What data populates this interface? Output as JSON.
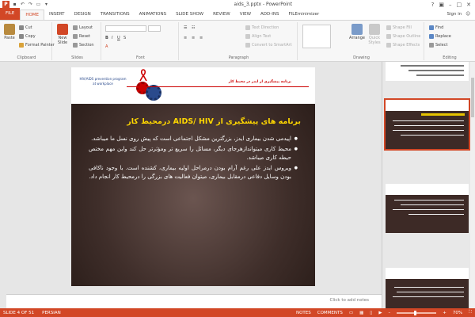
{
  "window": {
    "title": "aids_3.pptx - PowerPoint",
    "sign_in": "Sign in",
    "help": "?"
  },
  "tabs": [
    "FILE",
    "HOME",
    "INSERT",
    "DESIGN",
    "TRANSITIONS",
    "ANIMATIONS",
    "SLIDE SHOW",
    "REVIEW",
    "VIEW",
    "ADD-INS",
    "FILEminimizer"
  ],
  "ribbon": {
    "clipboard": {
      "label": "Clipboard",
      "paste": "Paste",
      "cut": "Cut",
      "copy": "Copy",
      "format_painter": "Format Painter"
    },
    "slides": {
      "label": "Slides",
      "new_slide": "New Slide",
      "layout": "Layout",
      "reset": "Reset",
      "section": "Section"
    },
    "font": {
      "label": "Font"
    },
    "paragraph": {
      "label": "Paragraph",
      "text_direction": "Text Direction",
      "align_text": "Align Text",
      "convert": "Convert to SmartArt"
    },
    "drawing": {
      "label": "Drawing",
      "arrange": "Arrange",
      "quick_styles": "Quick Styles",
      "shape_fill": "Shape Fill",
      "shape_outline": "Shape Outline",
      "shape_effects": "Shape Effects"
    },
    "editing": {
      "label": "Editing",
      "find": "Find",
      "replace": "Replace",
      "select": "Select"
    }
  },
  "slide": {
    "header_left": "HIV/AIDS prevention program at workplace",
    "header_right": "برنامه پیشگیری از ایدز در محیط کار",
    "title": "برنامه های پیشگیری از  AIDS/ HIV درمحیط کار",
    "bullets": [
      "اپیدمی شدن بیماری ایدز، بزرگترین مشکل اجتماعی است که پیش روی نسل ما میباشد.",
      "محیط کاری میتواندازهرجای دیگر، مسائل را سریع تر ومؤثرتر حل کند واین مهم مختص حیطه کاری میباشد.",
      "ویروس ایدز علی رغم آرام بودن درمراحل اولیه بیماری، کشنده است. با وجود ناکافی بودن وسایل دفاعی درمقابل بیماری، میتوان فعالیت های بزرگی را درمحیط کار انجام داد."
    ]
  },
  "notes_placeholder": "Click to add notes",
  "thumbnails": {
    "top_text": "بیان کنید که در انجام این وظیفه...",
    "numbers": [
      "4",
      "5",
      "6"
    ]
  },
  "status": {
    "slide": "SLIDE 4 OF 51",
    "language": "PERSIAN",
    "notes": "NOTES",
    "comments": "COMMENTS",
    "zoom": "70%"
  }
}
